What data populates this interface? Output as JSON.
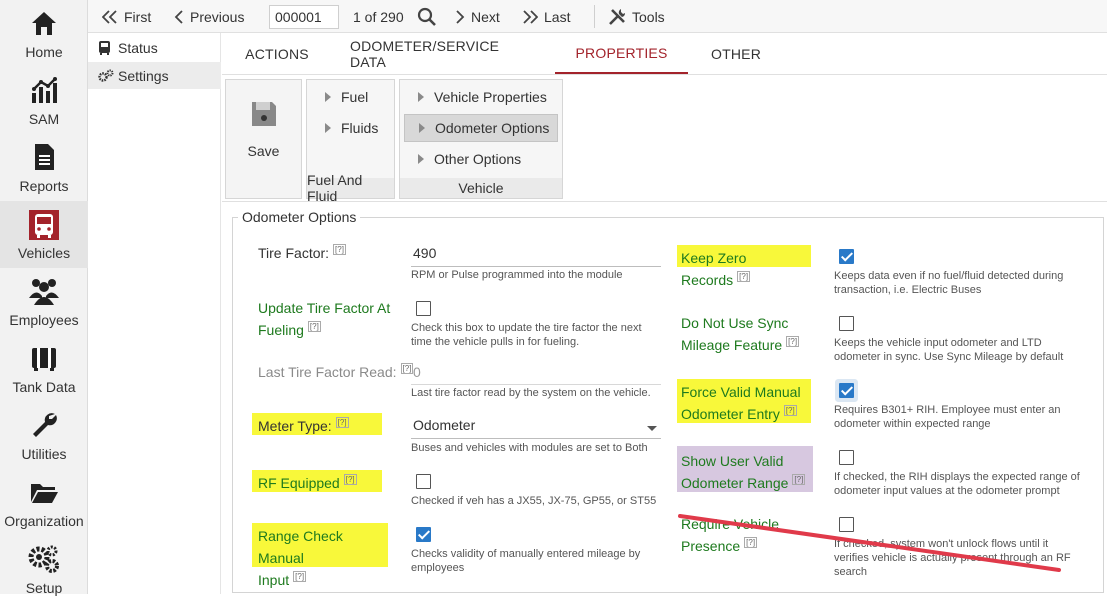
{
  "nav": {
    "items": [
      {
        "label": "Home",
        "icon": "home-icon"
      },
      {
        "label": "SAM",
        "icon": "chart-icon"
      },
      {
        "label": "Reports",
        "icon": "document-icon"
      },
      {
        "label": "Vehicles",
        "icon": "bus-icon"
      },
      {
        "label": "Employees",
        "icon": "people-icon"
      },
      {
        "label": "Tank Data",
        "icon": "tank-icon"
      },
      {
        "label": "Utilities",
        "icon": "wrench-icon"
      },
      {
        "label": "Organization",
        "icon": "folder-icon"
      },
      {
        "label": "Setup",
        "icon": "gears-icon"
      }
    ],
    "active": "Vehicles",
    "accent": "#a3232b"
  },
  "subnav": {
    "items": [
      {
        "label": "Status",
        "icon": "bus-small-icon"
      },
      {
        "label": "Settings",
        "icon": "gears-small-icon"
      }
    ],
    "active": "Settings"
  },
  "toolbar": {
    "first": "First",
    "previous": "Previous",
    "record_value": "000001",
    "record_count": "1 of 290",
    "next": "Next",
    "last": "Last",
    "tools": "Tools"
  },
  "tabs": [
    "ACTIONS",
    "ODOMETER/SERVICE DATA",
    "PROPERTIES",
    "OTHER"
  ],
  "active_tab": "PROPERTIES",
  "ribbon": {
    "save": "Save",
    "fuel_group": {
      "title": "Fuel And Fluid",
      "items": [
        "Fuel",
        "Fluids"
      ]
    },
    "vehicle_group": {
      "title": "Vehicle",
      "items": [
        "Vehicle Properties",
        "Odometer Options",
        "Other Options"
      ],
      "active": "Odometer Options"
    }
  },
  "section_title": "Odometer Options",
  "help_marker": "[?]",
  "left_fields": {
    "tire_factor": {
      "label": "Tire Factor:",
      "value": "490",
      "help": "RPM or Pulse programmed into the module"
    },
    "update_tire": {
      "label_line1": "Update Tire Factor At",
      "label_line2": "Fueling",
      "checked": false,
      "help_line1": "Check this box to update the tire factor the next",
      "help_line2": "time the vehicle pulls in for fueling."
    },
    "last_tire": {
      "label": "Last Tire Factor Read:",
      "value": "0",
      "help": "Last tire factor read by the system on the vehicle."
    },
    "meter_type": {
      "label": "Meter Type:",
      "value": "Odometer",
      "help": "Buses and vehicles with modules are set to Both"
    },
    "rf_equipped": {
      "label": "RF Equipped",
      "checked": false,
      "help": "Checked if veh has a JX55, JX-75, GP55, or ST55"
    },
    "range_check": {
      "label_line1": "Range Check Manual",
      "label_line2": "Input",
      "checked": true,
      "help_line1": "Checks validity of manually entered mileage by",
      "help_line2": "employees"
    }
  },
  "right_fields": {
    "keep_zero": {
      "label": "Keep Zero Records",
      "checked": true,
      "help_line1": "Keeps data even if no fuel/fluid detected during",
      "help_line2": "transaction, i.e. Electric Buses"
    },
    "no_sync": {
      "label_line1": "Do Not Use Sync",
      "label_line2": "Mileage Feature",
      "checked": false,
      "help_line1": "Keeps the vehicle input odometer and LTD",
      "help_line2": "odometer in sync. Use Sync Mileage by default"
    },
    "force_valid": {
      "label_line1": "Force Valid Manual",
      "label_line2": "Odometer Entry",
      "checked": true,
      "help_line1": "Requires B301+ RIH. Employee must enter an",
      "help_line2": "odometer within expected range"
    },
    "show_valid": {
      "label_line1": "Show User Valid",
      "label_line2": "Odometer Range",
      "checked": false,
      "help_line1": "If checked, the RIH displays the expected range of",
      "help_line2": "odometer input values at the odometer prompt"
    },
    "require_presence": {
      "label_line1": "Require Vehicle",
      "label_line2": "Presence",
      "checked": false,
      "help_line1": "If checked, system won't unlock flows until it",
      "help_line2": "verifies vehicle is actually present through an RF",
      "help_line3": "search"
    }
  },
  "colors": {
    "highlight_yellow": "#f8f83a",
    "highlight_purple": "#d7c8e0",
    "label_green": "#1e7a1e",
    "checkbox_blue": "#2979c8",
    "annotation_red": "#e03a4a"
  }
}
